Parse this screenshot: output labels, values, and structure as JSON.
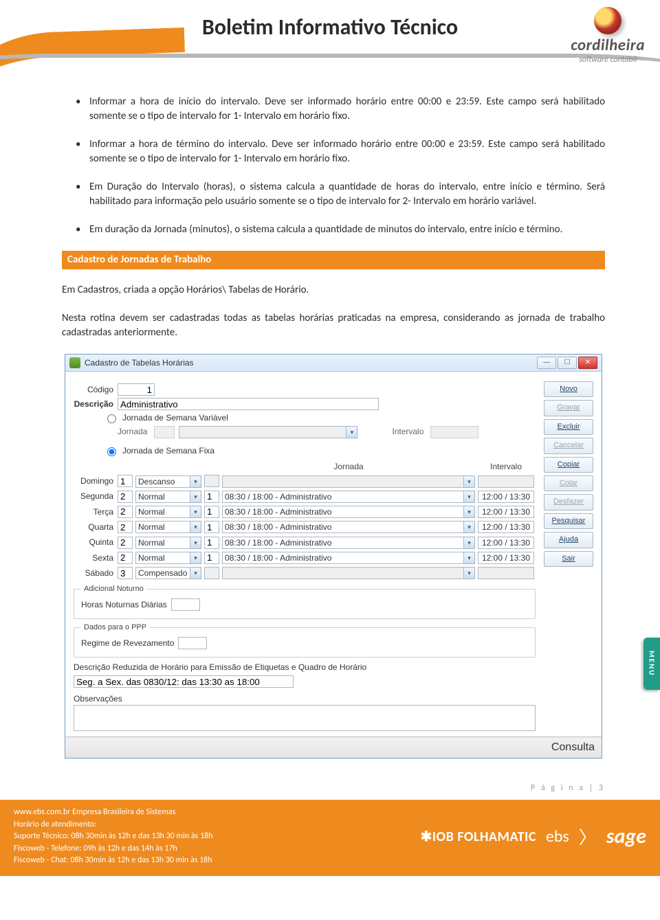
{
  "header": {
    "title": "Boletim Informativo Técnico",
    "brand_name": "cordilheira",
    "brand_tag": "software contábil"
  },
  "bullets": [
    "Informar a hora de início do intervalo. Deve ser informado horário entre 00:00 e 23:59. Este campo será habilitado somente se o tipo de intervalo for 1- Intervalo em horário fixo.",
    "Informar a hora de término do intervalo. Deve ser informado horário entre 00:00 e 23:59. Este campo será habilitado somente se o tipo de intervalo for 1- Intervalo em horário fixo.",
    "Em Duração do Intervalo (horas), o sistema calcula a quantidade de horas do intervalo, entre início e término. Será habilitado para informação pelo usuário somente se o tipo de intervalo for 2- Intervalo em horário variável.",
    "Em duração da Jornada (minutos), o sistema calcula a quantidade de minutos do intervalo, entre início e término."
  ],
  "section_title": "Cadastro de Jornadas de Trabalho",
  "para1": "Em Cadastros, criada a opção Horários\\ Tabelas de Horário.",
  "para2": "Nesta rotina devem ser cadastradas todas as tabelas horárias praticadas na empresa, considerando as jornada de trabalho cadastradas anteriormente.",
  "app": {
    "title": "Cadastro de Tabelas Horárias",
    "labels": {
      "codigo": "Código",
      "descricao": "Descrição",
      "radio_var": "Jornada de Semana Variável",
      "radio_fix": "Jornada de Semana Fixa",
      "jornada": "Jornada",
      "intervalo": "Intervalo",
      "adicional": "Adicional Noturno",
      "horas_not": "Horas Noturnas Diárias",
      "ppp": "Dados para o PPP",
      "regime": "Regime de Revezamento",
      "desc_reduz": "Descrição Reduzida de Horário para Emissão de Etiquetas e Quadro de Horário",
      "obs": "Observações"
    },
    "values": {
      "codigo": "1",
      "descricao": "Administrativo",
      "desc_reduz_val": "Seg. a Sex. das 0830/12: das 13:30 as 18:00"
    },
    "columns": {
      "jornada": "Jornada",
      "intervalo": "Intervalo"
    },
    "days": [
      {
        "name": "Domingo",
        "code": "1",
        "type": "Descanso",
        "jn": "",
        "jornada": "",
        "intervalo": ""
      },
      {
        "name": "Segunda",
        "code": "2",
        "type": "Normal",
        "jn": "1",
        "jornada": "08:30 / 18:00 - Administrativo",
        "intervalo": "12:00 / 13:30"
      },
      {
        "name": "Terça",
        "code": "2",
        "type": "Normal",
        "jn": "1",
        "jornada": "08:30 / 18:00 - Administrativo",
        "intervalo": "12:00 / 13:30"
      },
      {
        "name": "Quarta",
        "code": "2",
        "type": "Normal",
        "jn": "1",
        "jornada": "08:30 / 18:00 - Administrativo",
        "intervalo": "12:00 / 13:30"
      },
      {
        "name": "Quinta",
        "code": "2",
        "type": "Normal",
        "jn": "1",
        "jornada": "08:30 / 18:00 - Administrativo",
        "intervalo": "12:00 / 13:30"
      },
      {
        "name": "Sexta",
        "code": "2",
        "type": "Normal",
        "jn": "1",
        "jornada": "08:30 / 18:00 - Administrativo",
        "intervalo": "12:00 / 13:30"
      },
      {
        "name": "Sábado",
        "code": "3",
        "type": "Compensado",
        "jn": "",
        "jornada": "",
        "intervalo": ""
      }
    ],
    "side_buttons": [
      {
        "label": "Novo",
        "disabled": false
      },
      {
        "label": "Gravar",
        "disabled": true
      },
      {
        "label": "Excluir",
        "disabled": false
      },
      {
        "label": "Cancelar",
        "disabled": true
      },
      {
        "label": "Copiar",
        "disabled": false
      },
      {
        "label": "Colar",
        "disabled": true
      },
      {
        "label": "Desfazer",
        "disabled": true
      },
      {
        "label": "Pesquisar",
        "disabled": false
      },
      {
        "label": "Ajuda",
        "disabled": false
      },
      {
        "label": "Sair",
        "disabled": false
      }
    ],
    "status": "Consulta",
    "menu_tab": "MENU"
  },
  "page_number": "P á g i n a | 3",
  "footer": {
    "line1": "www.ebs.com.br Empresa Brasileira de Sistemas",
    "line2": "Horário de atendimento:",
    "line3": "Suporte Técnico: 08h 30min às 12h e das 13h 30 min às 18h",
    "line4": "Fiscoweb - Telefone: 09h às 12h e das 14h às 17h",
    "line5": "Fiscoweb - Chat: 08h 30min às 12h e das 13h 30 min às 18h",
    "iob": "✱IOB FOLHAMATIC",
    "ebs": "ebs",
    "sage": "sage"
  }
}
